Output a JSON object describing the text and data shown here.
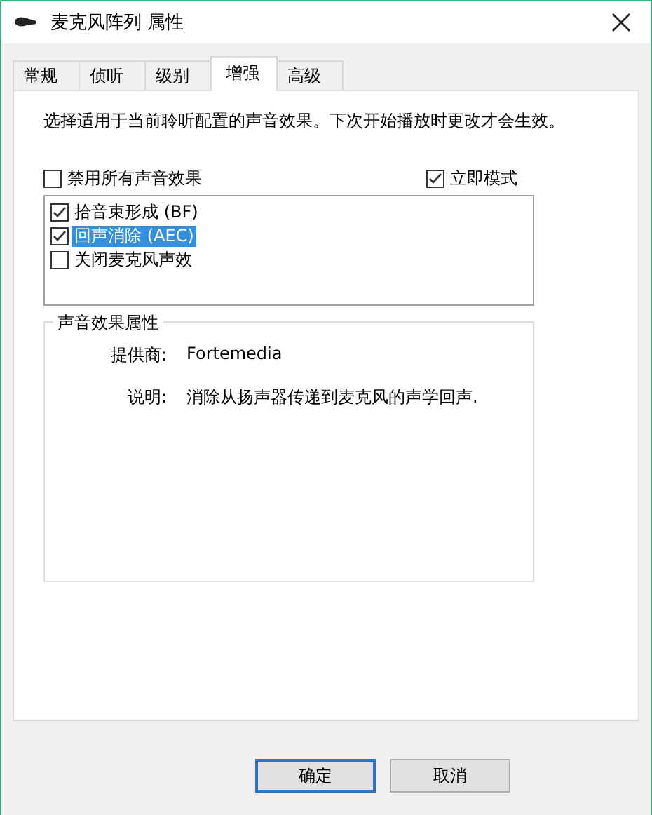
{
  "window": {
    "title": "麦克风阵列 属性"
  },
  "tabs": [
    {
      "label": "常规",
      "selected": false
    },
    {
      "label": "侦听",
      "selected": false
    },
    {
      "label": "级别",
      "selected": false
    },
    {
      "label": "增强",
      "selected": true
    },
    {
      "label": "高级",
      "selected": false
    }
  ],
  "description": "选择适用于当前聆听配置的声音效果。下次开始播放时更改才会生效。",
  "disable_all": {
    "label": "禁用所有声音效果",
    "checked": false
  },
  "immediate_mode": {
    "label": "立即模式",
    "checked": true
  },
  "effects": [
    {
      "label": "拾音束形成 (BF)",
      "checked": true,
      "selected": false
    },
    {
      "label": "回声消除 (AEC)",
      "checked": true,
      "selected": true
    },
    {
      "label": "关闭麦克风声效",
      "checked": false,
      "selected": false
    }
  ],
  "properties": {
    "title": "声音效果属性",
    "rows": [
      {
        "label": "提供商:",
        "value": "Fortemedia"
      },
      {
        "label": "说明:",
        "value": "消除从扬声器传递到麦克风的声学回声."
      }
    ]
  },
  "buttons": [
    {
      "label": "确定",
      "kind": "default"
    },
    {
      "label": "取消",
      "kind": "normal"
    }
  ]
}
